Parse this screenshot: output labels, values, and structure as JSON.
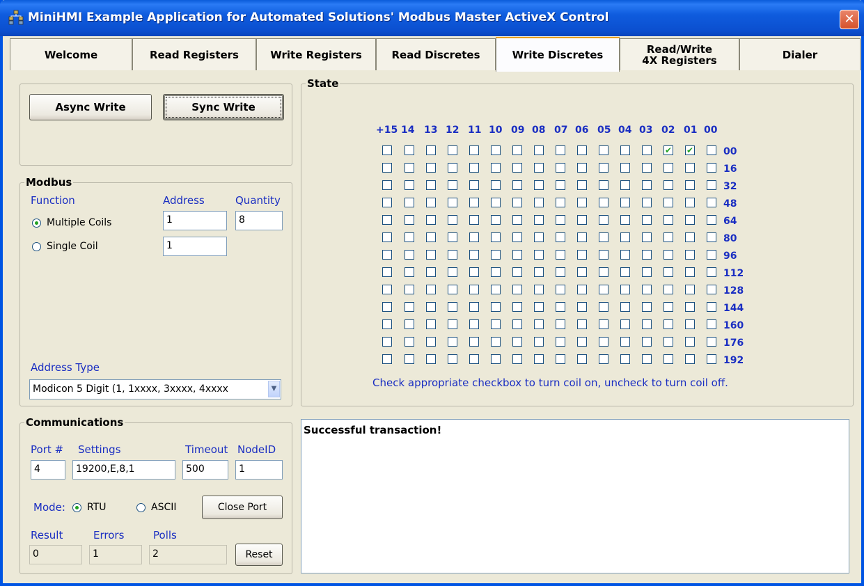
{
  "window": {
    "title": "MiniHMI Example Application for Automated Solutions' Modbus Master ActiveX Control",
    "close_glyph": "✕"
  },
  "tabs": [
    {
      "label": "Welcome",
      "active": false
    },
    {
      "label": "Read  Registers",
      "active": false
    },
    {
      "label": "Write  Registers",
      "active": false
    },
    {
      "label": "Read  Discretes",
      "active": false
    },
    {
      "label": "Write Discretes",
      "active": true
    },
    {
      "label": "Read/Write  4X Registers",
      "active": false
    },
    {
      "label": "Dialer",
      "active": false
    }
  ],
  "actions": {
    "async_write": "Async Write",
    "sync_write": "Sync Write"
  },
  "modbus": {
    "title": "Modbus",
    "function_label": "Function",
    "address_label": "Address",
    "quantity_label": "Quantity",
    "multiple_coils": "Multiple Coils",
    "single_coil": "Single Coil",
    "multiple_address": "1",
    "multiple_quantity": "8",
    "single_address": "1",
    "selected_function": "Multiple Coils",
    "address_type_label": "Address Type",
    "address_type_value": "Modicon 5 Digit (1, 1xxxx, 3xxxx, 4xxxx"
  },
  "state": {
    "title": "State",
    "columns": [
      "+15",
      "14",
      "13",
      "12",
      "11",
      "10",
      "09",
      "08",
      "07",
      "06",
      "05",
      "04",
      "03",
      "02",
      "01",
      "00"
    ],
    "rows": [
      "00",
      "16",
      "32",
      "48",
      "64",
      "80",
      "96",
      "112",
      "128",
      "144",
      "160",
      "176",
      "192"
    ],
    "checked": [
      {
        "row": "00",
        "bit": "02"
      },
      {
        "row": "00",
        "bit": "01"
      }
    ],
    "hint": "Check appropriate checkbox to turn coil on, uncheck to turn coil off."
  },
  "communications": {
    "title": "Communications",
    "port_label": "Port #",
    "settings_label": "Settings",
    "timeout_label": "Timeout",
    "nodeid_label": "NodeID",
    "port": "4",
    "settings": "19200,E,8,1",
    "timeout": "500",
    "nodeid": "1",
    "mode_label": "Mode:",
    "rtu": "RTU",
    "ascii": "ASCII",
    "selected_mode": "RTU",
    "close_port": "Close Port",
    "result_label": "Result",
    "errors_label": "Errors",
    "polls_label": "Polls",
    "result": "0",
    "errors": "1",
    "polls": "2",
    "reset": "Reset"
  },
  "log": {
    "message": "Successful transaction!"
  }
}
